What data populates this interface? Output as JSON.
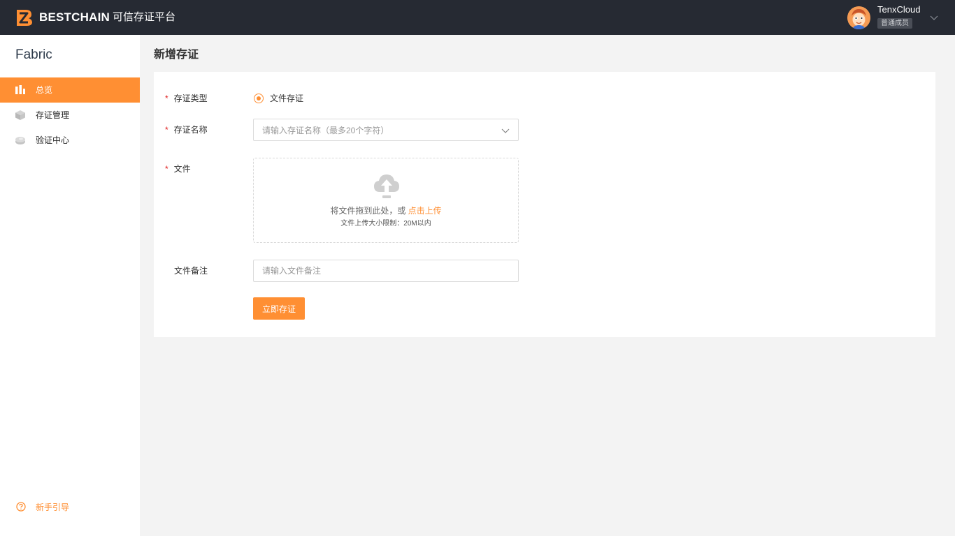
{
  "header": {
    "brand": "BESTCHAIN",
    "brand_sub": "可信存证平台",
    "user": {
      "name": "TenxCloud",
      "role": "普通成员"
    }
  },
  "sidebar": {
    "title": "Fabric",
    "items": [
      {
        "label": "总览",
        "icon": "bar-chart-icon",
        "active": true
      },
      {
        "label": "存证管理",
        "icon": "cube-icon",
        "active": false
      },
      {
        "label": "验证中心",
        "icon": "stack-icon",
        "active": false
      }
    ],
    "guide": {
      "label": "新手引导",
      "icon": "help-circle-icon"
    }
  },
  "main": {
    "page_title": "新增存证",
    "form": {
      "type_label": "存证类型",
      "type_option": "文件存证",
      "name_label": "存证名称",
      "name_placeholder": "请输入存证名称（最多20个字符）",
      "file_label": "文件",
      "upload_tip": "将文件拖到此处，或",
      "upload_link": "点击上传",
      "upload_limit": "文件上传大小限制：20M以内",
      "remark_label": "文件备注",
      "remark_placeholder": "请输入文件备注",
      "submit_label": "立即存证",
      "required_mark": "*"
    }
  },
  "colors": {
    "accent": "#ff8f33",
    "topbar": "#262a33",
    "background": "#f3f3f3"
  }
}
